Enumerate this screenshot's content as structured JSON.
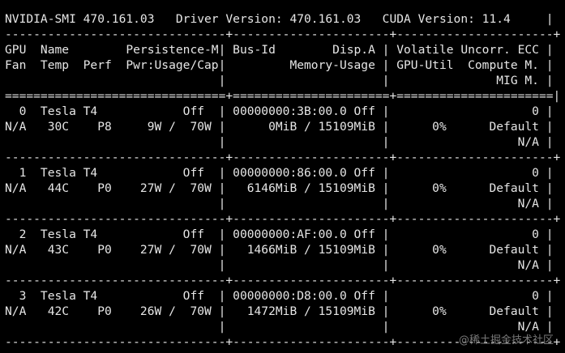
{
  "terminal": {
    "lines": [
      "NVIDIA-SMI 470.161.03   Driver Version: 470.161.03   CUDA Version: 11.4     |",
      "-------------------------------+----------------------+----------------------+",
      "GPU  Name        Persistence-M| Bus-Id        Disp.A | Volatile Uncorr. ECC |",
      "Fan  Temp  Perf  Pwr:Usage/Cap|         Memory-Usage | GPU-Util  Compute M. |",
      "                              |                      |               MIG M. |",
      "===============================+======================+======================|",
      "  0  Tesla T4            Off  | 00000000:3B:00.0 Off |                    0 |",
      "N/A   30C    P8     9W /  70W |      0MiB / 15109MiB |      0%      Default |",
      "                              |                      |                  N/A |",
      "-------------------------------+----------------------+----------------------+",
      "  1  Tesla T4            Off  | 00000000:86:00.0 Off |                    0 |",
      "N/A   44C    P0    27W /  70W |   6146MiB / 15109MiB |      0%      Default |",
      "                              |                      |                  N/A |",
      "-------------------------------+----------------------+----------------------+",
      "  2  Tesla T4            Off  | 00000000:AF:00.0 Off |                    0 |",
      "N/A   43C    P0    27W /  70W |   1466MiB / 15109MiB |      0%      Default |",
      "                              |                      |                  N/A |",
      "-------------------------------+----------------------+----------------------+",
      "  3  Tesla T4            Off  | 00000000:D8:00.0 Off |                    0 |",
      "N/A   42C    P0    26W /  70W |   1472MiB / 15109MiB |      0%      Default |",
      "                              |                      |                  N/A |",
      "-------------------------------+----------------------+----------------------+"
    ]
  },
  "watermark": {
    "text": "@稀土掘金技术社区"
  }
}
